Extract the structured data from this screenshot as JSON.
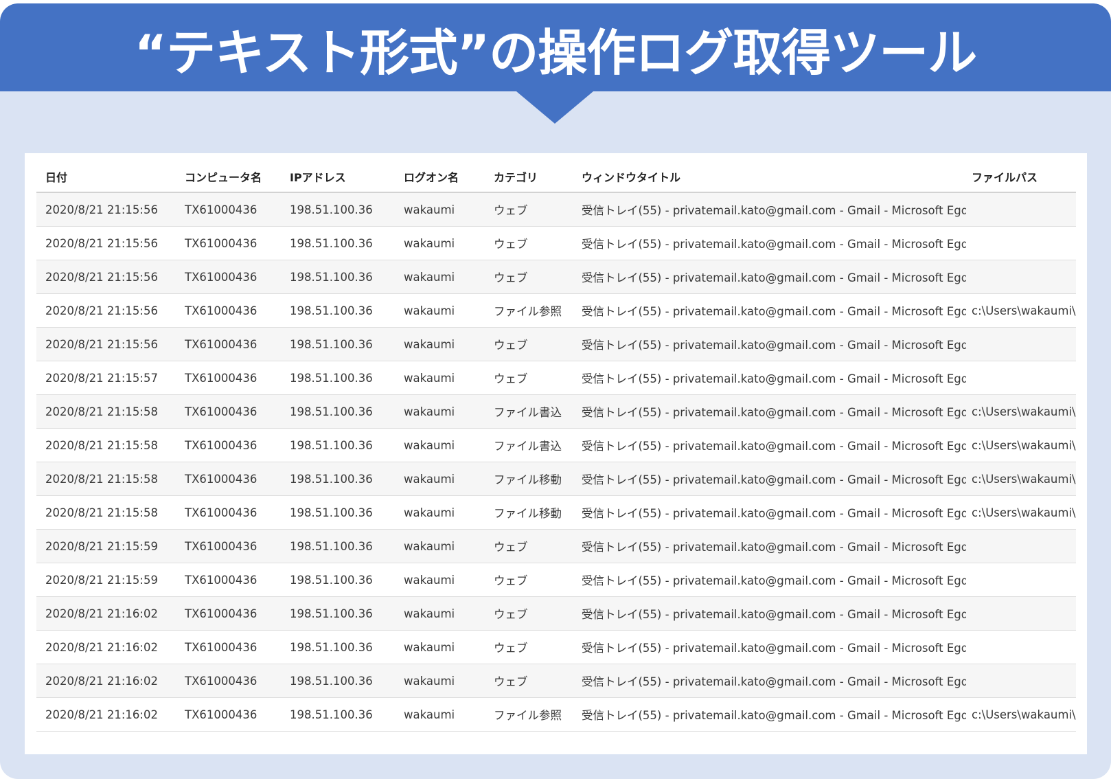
{
  "title": "“テキスト形式”の操作ログ取得ツール",
  "columns": {
    "date": "日付",
    "computer": "コンピュータ名",
    "ip": "IPアドレス",
    "logon": "ログオン名",
    "category": "カテゴリ",
    "window_title": "ウィンドウタイトル",
    "file_path": "ファイルパス"
  },
  "rows": [
    {
      "date": "2020/8/21 21:15:56",
      "computer": "TX61000436",
      "ip": "198.51.100.36",
      "logon": "wakaumi",
      "category": "ウェブ",
      "window_title": "受信トレイ(55) - privatemail.kato@gmail.com - Gmail - Microsoft Egde",
      "file_path": ""
    },
    {
      "date": "2020/8/21 21:15:56",
      "computer": "TX61000436",
      "ip": "198.51.100.36",
      "logon": "wakaumi",
      "category": "ウェブ",
      "window_title": "受信トレイ(55) - privatemail.kato@gmail.com - Gmail - Microsoft Egde",
      "file_path": ""
    },
    {
      "date": "2020/8/21 21:15:56",
      "computer": "TX61000436",
      "ip": "198.51.100.36",
      "logon": "wakaumi",
      "category": "ウェブ",
      "window_title": "受信トレイ(55) - privatemail.kato@gmail.com - Gmail - Microsoft Egde",
      "file_path": ""
    },
    {
      "date": "2020/8/21 21:15:56",
      "computer": "TX61000436",
      "ip": "198.51.100.36",
      "logon": "wakaumi",
      "category": "ファイル参照",
      "window_title": "受信トレイ(55) - privatemail.kato@gmail.com - Gmail - Microsoft Egde",
      "file_path": "c:\\Users\\wakaumi\\Desktop"
    },
    {
      "date": "2020/8/21 21:15:56",
      "computer": "TX61000436",
      "ip": "198.51.100.36",
      "logon": "wakaumi",
      "category": "ウェブ",
      "window_title": "受信トレイ(55) - privatemail.kato@gmail.com - Gmail - Microsoft Egde",
      "file_path": ""
    },
    {
      "date": "2020/8/21 21:15:57",
      "computer": "TX61000436",
      "ip": "198.51.100.36",
      "logon": "wakaumi",
      "category": "ウェブ",
      "window_title": "受信トレイ(55) - privatemail.kato@gmail.com - Gmail - Microsoft Egde",
      "file_path": ""
    },
    {
      "date": "2020/8/21 21:15:58",
      "computer": "TX61000436",
      "ip": "198.51.100.36",
      "logon": "wakaumi",
      "category": "ファイル書込",
      "window_title": "受信トレイ(55) - privatemail.kato@gmail.com - Gmail - Microsoft Egde",
      "file_path": "c:\\Users\\wakaumi\\Desktop"
    },
    {
      "date": "2020/8/21 21:15:58",
      "computer": "TX61000436",
      "ip": "198.51.100.36",
      "logon": "wakaumi",
      "category": "ファイル書込",
      "window_title": "受信トレイ(55) - privatemail.kato@gmail.com - Gmail - Microsoft Egde",
      "file_path": "c:\\Users\\wakaumi\\Desktop"
    },
    {
      "date": "2020/8/21 21:15:58",
      "computer": "TX61000436",
      "ip": "198.51.100.36",
      "logon": "wakaumi",
      "category": "ファイル移動",
      "window_title": "受信トレイ(55) - privatemail.kato@gmail.com - Gmail - Microsoft Egde",
      "file_path": "c:\\Users\\wakaumi\\Desktop"
    },
    {
      "date": "2020/8/21 21:15:58",
      "computer": "TX61000436",
      "ip": "198.51.100.36",
      "logon": "wakaumi",
      "category": "ファイル移動",
      "window_title": "受信トレイ(55) - privatemail.kato@gmail.com - Gmail - Microsoft Egde",
      "file_path": "c:\\Users\\wakaumi\\Desktop"
    },
    {
      "date": "2020/8/21 21:15:59",
      "computer": "TX61000436",
      "ip": "198.51.100.36",
      "logon": "wakaumi",
      "category": "ウェブ",
      "window_title": "受信トレイ(55) - privatemail.kato@gmail.com - Gmail - Microsoft Egde",
      "file_path": ""
    },
    {
      "date": "2020/8/21 21:15:59",
      "computer": "TX61000436",
      "ip": "198.51.100.36",
      "logon": "wakaumi",
      "category": "ウェブ",
      "window_title": "受信トレイ(55) - privatemail.kato@gmail.com - Gmail - Microsoft Egde",
      "file_path": ""
    },
    {
      "date": "2020/8/21 21:16:02",
      "computer": "TX61000436",
      "ip": "198.51.100.36",
      "logon": "wakaumi",
      "category": "ウェブ",
      "window_title": "受信トレイ(55) - privatemail.kato@gmail.com - Gmail - Microsoft Egde",
      "file_path": ""
    },
    {
      "date": "2020/8/21 21:16:02",
      "computer": "TX61000436",
      "ip": "198.51.100.36",
      "logon": "wakaumi",
      "category": "ウェブ",
      "window_title": "受信トレイ(55) - privatemail.kato@gmail.com - Gmail - Microsoft Egde",
      "file_path": ""
    },
    {
      "date": "2020/8/21 21:16:02",
      "computer": "TX61000436",
      "ip": "198.51.100.36",
      "logon": "wakaumi",
      "category": "ウェブ",
      "window_title": "受信トレイ(55) - privatemail.kato@gmail.com - Gmail - Microsoft Egde",
      "file_path": ""
    },
    {
      "date": "2020/8/21 21:16:02",
      "computer": "TX61000436",
      "ip": "198.51.100.36",
      "logon": "wakaumi",
      "category": "ファイル参照",
      "window_title": "受信トレイ(55) - privatemail.kato@gmail.com - Gmail - Microsoft Egde",
      "file_path": "c:\\Users\\wakaumi\\Desktop"
    }
  ]
}
